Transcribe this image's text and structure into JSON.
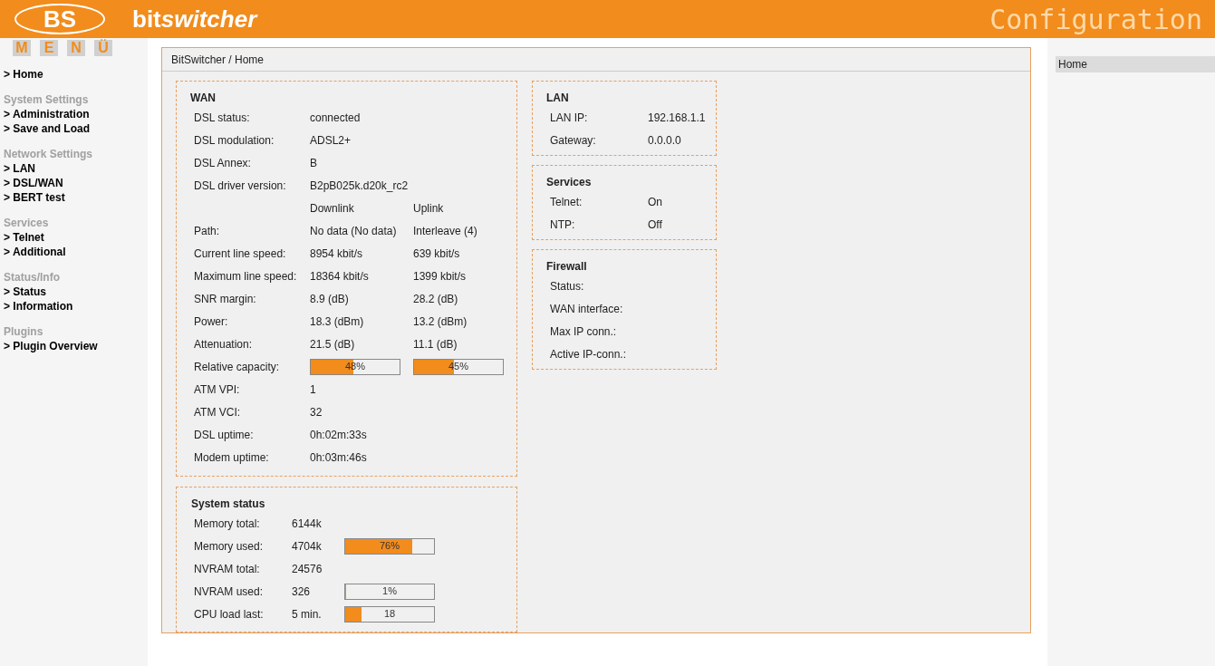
{
  "header": {
    "logo": "BS",
    "brand_parts": [
      "bit",
      "switcher"
    ],
    "title": "Configuration"
  },
  "menu_letters": [
    "M",
    "E",
    "N",
    "Ü"
  ],
  "sidebar": {
    "groups": [
      {
        "items": [
          "> Home"
        ]
      },
      {
        "title": "System Settings",
        "items": [
          "> Administration",
          "> Save and Load"
        ]
      },
      {
        "title": "Network Settings",
        "items": [
          "> LAN",
          "> DSL/WAN",
          "> BERT test"
        ]
      },
      {
        "title": "Services",
        "items": [
          "> Telnet",
          "> Additional"
        ]
      },
      {
        "title": "Status/Info",
        "items": [
          "> Status",
          "> Information"
        ]
      },
      {
        "title": "Plugins",
        "items": [
          "> Plugin Overview"
        ]
      }
    ]
  },
  "breadcrumb": "BitSwitcher / Home",
  "wan": {
    "title": "WAN",
    "rows": [
      {
        "kind": "single",
        "label": "DSL status:",
        "value": "connected"
      },
      {
        "kind": "single",
        "label": "DSL modulation:",
        "value": "ADSL2+"
      },
      {
        "kind": "single",
        "label": "DSL Annex:",
        "value": "B"
      },
      {
        "kind": "single",
        "label": "DSL driver version:",
        "value": "B2pB025k.d20k_rc2"
      },
      {
        "kind": "columns",
        "values": [
          "Downlink",
          "Uplink"
        ]
      },
      {
        "kind": "pair",
        "label": "Path:",
        "values": [
          "No data (No data)",
          "Interleave (4)"
        ]
      },
      {
        "kind": "pair",
        "label": "Current line speed:",
        "values": [
          "8954 kbit/s",
          "639 kbit/s"
        ]
      },
      {
        "kind": "pair",
        "label": "Maximum line speed:",
        "values": [
          "18364 kbit/s",
          "1399 kbit/s"
        ]
      },
      {
        "kind": "pair",
        "label": "SNR margin:",
        "values": [
          "8.9 (dB)",
          "28.2 (dB)"
        ]
      },
      {
        "kind": "pair",
        "label": "Power:",
        "values": [
          "18.3 (dBm)",
          "13.2 (dBm)"
        ]
      },
      {
        "kind": "pair",
        "label": "Attenuation:",
        "values": [
          "21.5 (dB)",
          "11.1 (dB)"
        ]
      },
      {
        "kind": "bars",
        "label": "Relative capacity:",
        "bars": [
          {
            "level": 0.48,
            "text": "48%"
          },
          {
            "level": 0.45,
            "text": "45%"
          }
        ]
      },
      {
        "kind": "single",
        "label": "ATM VPI:",
        "value": "1"
      },
      {
        "kind": "single",
        "label": "ATM VCI:",
        "value": "32"
      },
      {
        "kind": "single",
        "label": "DSL uptime:",
        "value": "0h:02m:33s"
      },
      {
        "kind": "single",
        "label": "Modem uptime:",
        "value": "0h:03m:46s"
      }
    ]
  },
  "system_status": {
    "title": "System status",
    "rows": [
      {
        "label": "Memory total:",
        "value": "6144k"
      },
      {
        "label": "Memory used:",
        "value": "4704k",
        "bar": {
          "level": 0.76,
          "text": "76%"
        }
      },
      {
        "label": "NVRAM total:",
        "value": "24576"
      },
      {
        "label": "NVRAM used:",
        "value": "326",
        "bar": {
          "level": 0.01,
          "text": "1%"
        }
      },
      {
        "label": "CPU load last:",
        "value": "5 min.",
        "bar": {
          "level": 0.18,
          "text": "18"
        }
      }
    ]
  },
  "side_boxes": [
    {
      "title": "LAN",
      "rows": [
        {
          "label": "LAN IP:",
          "value": "192.168.1.1"
        },
        {
          "label": "Gateway:",
          "value": "0.0.0.0"
        }
      ]
    },
    {
      "title": "Services",
      "rows": [
        {
          "label": "Telnet:",
          "value": "On"
        },
        {
          "label": "NTP:",
          "value": "Off"
        }
      ]
    },
    {
      "title": "Firewall",
      "rows": [
        {
          "label": "Status:"
        },
        {
          "label": "WAN interface:"
        },
        {
          "label": "Max IP conn.:"
        },
        {
          "label": "Active IP-conn.:"
        }
      ]
    }
  ],
  "right_panel": {
    "item": "Home"
  }
}
